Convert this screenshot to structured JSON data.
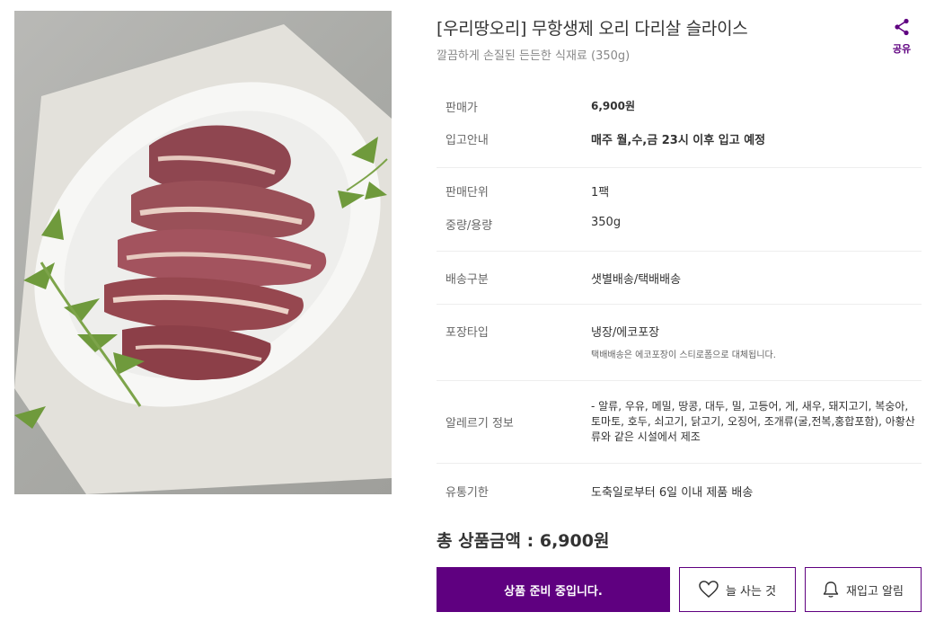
{
  "product": {
    "title": "[우리땅오리] 무항생제 오리 다리살 슬라이스",
    "subtitle": "깔끔하게 손질된 든든한 식재료 (350g)"
  },
  "share": {
    "label": "공유",
    "icon": "share-icon"
  },
  "info": {
    "price_label": "판매가",
    "price_value": "6,900원",
    "arrival_label": "입고안내",
    "arrival_value": "매주 월,수,금 23시 이후 입고 예정",
    "unit_label": "판매단위",
    "unit_value": "1팩",
    "weight_label": "중량/용량",
    "weight_value": "350g",
    "delivery_label": "배송구분",
    "delivery_value": "샛별배송/택배배송",
    "package_label": "포장타입",
    "package_value": "냉장/에코포장",
    "package_note": "택배배송은 에코포장이 스티로폼으로 대체됩니다.",
    "allergy_label": "알레르기 정보",
    "allergy_value": "- 알류, 우유, 메밀, 땅콩, 대두, 밀, 고등어, 게, 새우, 돼지고기, 복숭아, 토마토, 호두, 쇠고기, 닭고기, 오징어, 조개류(굴,전복,홍합포함), 아황산류와 같은 시설에서 제조",
    "expiry_label": "유통기한",
    "expiry_value": "도축일로부터 6일 이내 제품 배송"
  },
  "total": {
    "text": "총 상품금액 : 6,900원"
  },
  "buttons": {
    "main_label": "상품 준비 중입니다.",
    "wish_label": "늘 사는 것",
    "alarm_label": "재입고 알림"
  },
  "colors": {
    "accent": "#5f0080"
  }
}
